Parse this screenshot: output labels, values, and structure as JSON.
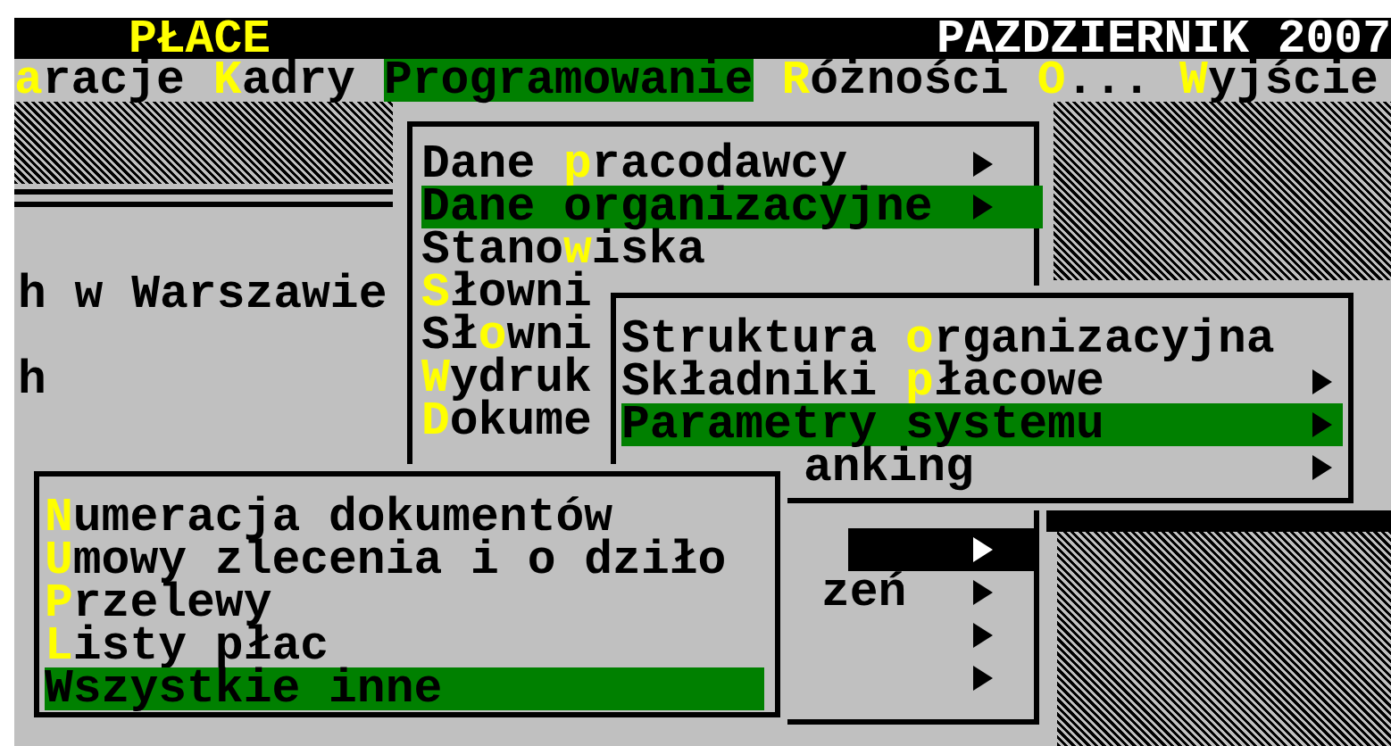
{
  "title_bar": {
    "app": "PŁACE",
    "date": "PAZDZIERNIK 2007"
  },
  "menu_bar": [
    {
      "hotkey": "a",
      "after": "racje",
      "selected": false
    },
    {
      "hotkey": "K",
      "after": "adry",
      "selected": false
    },
    {
      "after": "Programowanie",
      "selected": true
    },
    {
      "hotkey": "R",
      "after": "óżności",
      "selected": false
    },
    {
      "hotkey": "O",
      "after": "...",
      "selected": false
    },
    {
      "hotkey": "W",
      "after": "yjście",
      "selected": false
    }
  ],
  "background_text": [
    "h w Warszawie",
    "h"
  ],
  "menus": [
    {
      "items": [
        {
          "kind": "item",
          "before": "Dane ",
          "hotkey": "p",
          "after": "racodawcy",
          "submenu": true,
          "selected": false
        },
        {
          "kind": "item",
          "after": "Dane organizacyjne",
          "submenu": true,
          "selected": true
        },
        {
          "kind": "item",
          "before": "Stano",
          "hotkey": "w",
          "after": "iska",
          "submenu": false,
          "selected": false
        },
        {
          "kind": "item",
          "hotkey": "S",
          "after": "łowni",
          "submenu": false,
          "selected": false
        },
        {
          "kind": "item",
          "before": "Sł",
          "hotkey": "o",
          "after": "wni",
          "submenu": false,
          "selected": false
        },
        {
          "kind": "item",
          "hotkey": "W",
          "after": "ydruk",
          "submenu": false,
          "selected": false
        },
        {
          "kind": "item",
          "hotkey": "D",
          "after": "okume",
          "submenu": false,
          "selected": false
        },
        {
          "kind": "blank"
        },
        {
          "kind": "blank"
        },
        {
          "kind": "shaded",
          "submenu": true
        },
        {
          "kind": "tail",
          "after": "zeń",
          "submenu": true,
          "selected": false
        },
        {
          "kind": "tail",
          "submenu": true,
          "selected": false
        },
        {
          "kind": "tail",
          "submenu": true,
          "selected": false
        }
      ]
    },
    {
      "items": [
        {
          "kind": "item",
          "before": "Struktura ",
          "hotkey": "o",
          "after": "rganizacyjna",
          "submenu": false,
          "selected": false
        },
        {
          "kind": "item",
          "before": "Składniki ",
          "hotkey": "p",
          "after": "łacowe",
          "submenu": true,
          "selected": false
        },
        {
          "kind": "item",
          "after": "Parametry systemu",
          "submenu": true,
          "selected": true
        },
        {
          "kind": "tail",
          "after": "anking",
          "submenu": true,
          "selected": false
        }
      ]
    },
    {
      "items": [
        {
          "kind": "item",
          "hotkey": "N",
          "after": "umeracja dokumentów",
          "submenu": false,
          "selected": false
        },
        {
          "kind": "item",
          "hotkey": "U",
          "after": "mowy zlecenia i o dziło",
          "submenu": false,
          "selected": false
        },
        {
          "kind": "item",
          "hotkey": "P",
          "after": "rzelewy",
          "submenu": false,
          "selected": false
        },
        {
          "kind": "item",
          "hotkey": "L",
          "after": "isty płac",
          "submenu": false,
          "selected": false
        },
        {
          "kind": "item",
          "after": "Wszystkie inne",
          "submenu": false,
          "selected": true
        }
      ]
    }
  ]
}
